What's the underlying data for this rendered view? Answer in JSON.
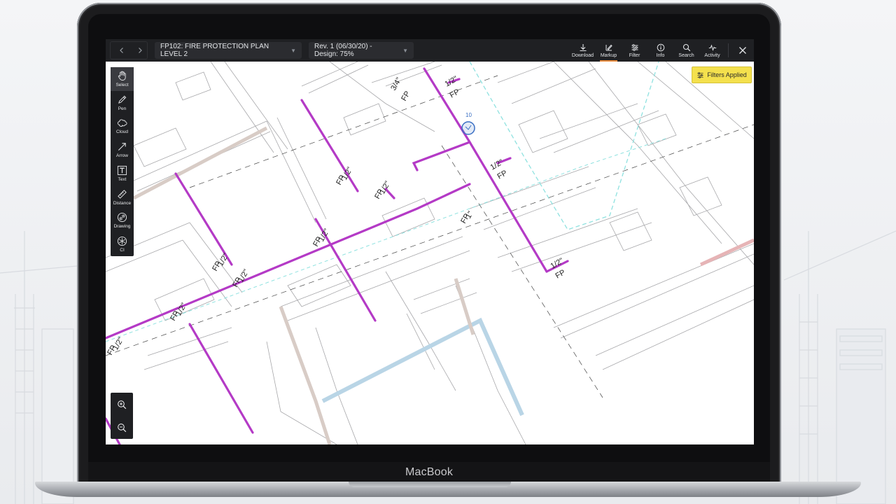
{
  "viewer": {
    "nav_prev_icon": "chevron-left-icon",
    "nav_next_icon": "chevron-right-icon",
    "sheet_select": "FP102: FIRE PROTECTION PLAN LEVEL 2",
    "revision_select": "Rev. 1 (06/30/20) - Design: 75%",
    "toolbar": [
      {
        "label": "Download",
        "icon": "download-icon"
      },
      {
        "label": "Markup",
        "icon": "markup-icon",
        "active": true
      },
      {
        "label": "Filter",
        "icon": "filter-icon"
      },
      {
        "label": "Info",
        "icon": "info-icon"
      },
      {
        "label": "Search",
        "icon": "search-icon"
      },
      {
        "label": "Activity",
        "icon": "activity-icon"
      }
    ],
    "close_icon": "close-icon",
    "filters_applied_label": "Filters Applied",
    "tools": [
      {
        "label": "Select",
        "icon": "hand-icon",
        "selected": true
      },
      {
        "label": "Pen",
        "icon": "pen-icon"
      },
      {
        "label": "Cloud",
        "icon": "cloud-icon"
      },
      {
        "label": "Arrow",
        "icon": "arrow-icon"
      },
      {
        "label": "Text",
        "icon": "text-icon"
      },
      {
        "label": "Distance",
        "icon": "ruler-icon"
      },
      {
        "label": "Drawing",
        "icon": "link-icon"
      },
      {
        "label": "CI",
        "icon": "ci-icon"
      }
    ],
    "zoom": [
      {
        "icon": "zoom-in-icon"
      },
      {
        "icon": "zoom-out-icon"
      }
    ],
    "drawing_labels": {
      "pipe_a": "1/2\"",
      "pipe_b": "3/4\"",
      "pipe_c": "1\"",
      "fp": "FP",
      "marker": "10"
    },
    "colors": {
      "pipe": "#b43ac6",
      "accent": "#e88b3e",
      "filters_bg": "#f4e04d",
      "marker": "#3a6fc4"
    }
  },
  "device": {
    "brand": "MacBook"
  }
}
